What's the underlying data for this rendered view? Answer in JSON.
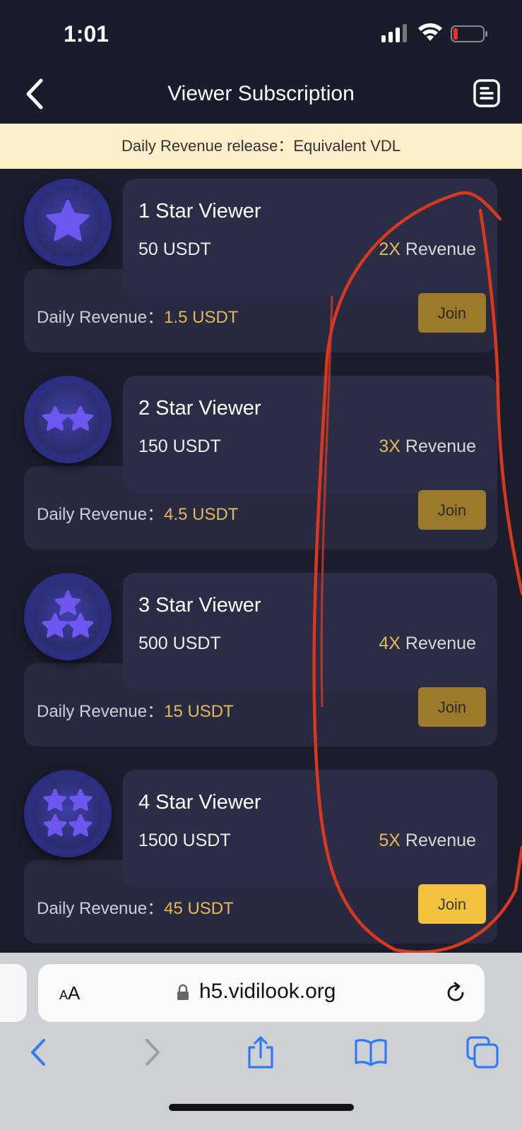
{
  "status_bar": {
    "time": "1:01"
  },
  "nav": {
    "title": "Viewer Subscription"
  },
  "banner": {
    "text": "Daily Revenue release：Equivalent VDL"
  },
  "plans": [
    {
      "name": "1 Star Viewer",
      "price": "50 USDT",
      "multiplier": "2X",
      "revenue_word": " Revenue",
      "daily_label": "Daily Revenue：",
      "daily_value": "1.5 USDT",
      "join_label": "Join",
      "stars": 1
    },
    {
      "name": "2 Star Viewer",
      "price": "150 USDT",
      "multiplier": "3X",
      "revenue_word": " Revenue",
      "daily_label": "Daily Revenue：",
      "daily_value": "4.5 USDT",
      "join_label": "Join",
      "stars": 2
    },
    {
      "name": "3 Star Viewer",
      "price": "500 USDT",
      "multiplier": "4X",
      "revenue_word": " Revenue",
      "daily_label": "Daily Revenue：",
      "daily_value": "15 USDT",
      "join_label": "Join",
      "stars": 3
    },
    {
      "name": "4 Star Viewer",
      "price": "1500 USDT",
      "multiplier": "5X",
      "revenue_word": " Revenue",
      "daily_label": "Daily Revenue：",
      "daily_value": "45 USDT",
      "join_label": "Join",
      "stars": 4
    }
  ],
  "browser": {
    "aa_label_small": "A",
    "aa_label": "A",
    "url": "h5.vidilook.org"
  },
  "colors": {
    "accent_gold": "#e5b955",
    "join_button": "#9c7a2c",
    "join_button_active": "#f2c23e",
    "star": "#6e57f0",
    "annotation_stroke": "#d8381e",
    "safari_blue": "#2f7bf5"
  }
}
